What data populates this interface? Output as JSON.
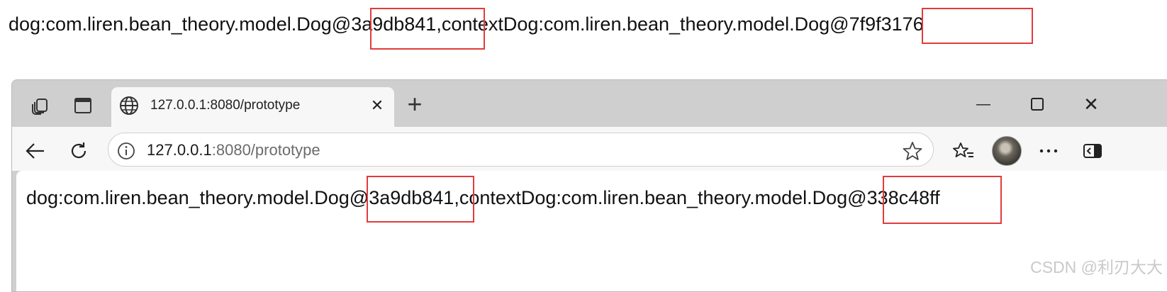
{
  "top_output": {
    "dog_prefix": "dog:com.liren.bean_theory.model.Dog",
    "dog_hash": "@3a9db841",
    "separator": ",",
    "context_prefix": "contextDog:com.liren.bean_theory.model.Dog",
    "context_hash": "@7f9f3176"
  },
  "browser": {
    "tab": {
      "title": "127.0.0.1:8080/prototype",
      "close_glyph": "✕",
      "new_tab_glyph": "+"
    },
    "window_controls": {
      "minimize": "—",
      "maximize": "☐",
      "close": "✕"
    },
    "address": {
      "host": "127.0.0.1",
      "rest": ":8080/prototype"
    },
    "page_output": {
      "dog_prefix": "dog:com.liren.bean_theory.model.Dog",
      "dog_hash": "@3a9db841",
      "separator": ",",
      "context_prefix": "contextDog:com.liren.bean_theory.model.Dog",
      "context_hash": "@338c48ff"
    }
  },
  "watermark": "CSDN @利刃大大",
  "highlight_color": "#e23b3b",
  "icons": [
    "workspaces-icon",
    "vertical-tabs-icon",
    "globe-icon",
    "tab-close-icon",
    "new-tab-icon",
    "back-icon",
    "refresh-icon",
    "site-info-icon",
    "favorite-star-icon",
    "favorites-list-icon",
    "profile-avatar",
    "more-icon",
    "sidebar-icon",
    "minimize-icon",
    "maximize-icon",
    "window-close-icon"
  ]
}
